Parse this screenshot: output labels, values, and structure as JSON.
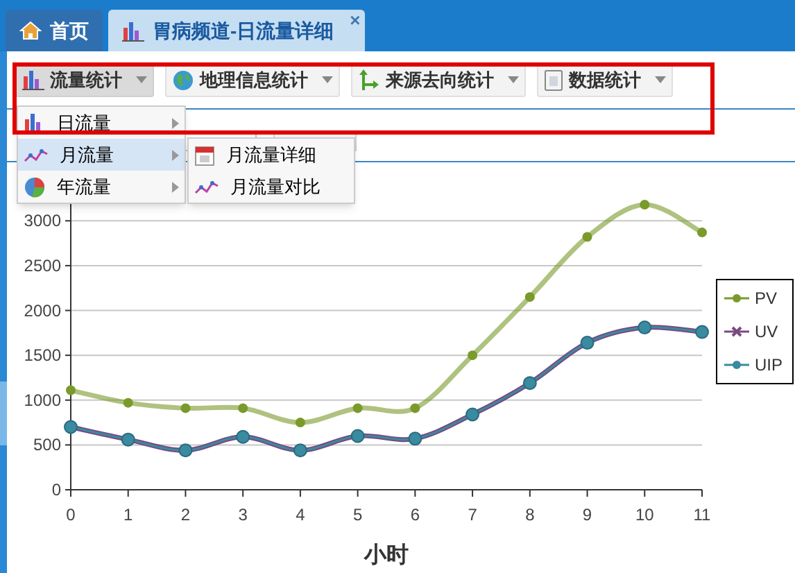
{
  "tabs": [
    {
      "label": "首页",
      "selected": false,
      "closable": false
    },
    {
      "label": "胃病频道-日流量详细",
      "selected": true,
      "closable": true
    }
  ],
  "close_symbol": "×",
  "toolbar": [
    {
      "label": "流量统计",
      "active": true
    },
    {
      "label": "地理信息统计",
      "active": false
    },
    {
      "label": "来源去向统计",
      "active": false
    },
    {
      "label": "数据统计",
      "active": false
    }
  ],
  "menu": [
    {
      "label": "日流量",
      "selected": false
    },
    {
      "label": "月流量",
      "selected": true
    },
    {
      "label": "年流量",
      "selected": false
    }
  ],
  "submenu": [
    {
      "label": "月流量详细"
    },
    {
      "label": "月流量对比"
    }
  ],
  "chart": {
    "chart_data": {
      "type": "line",
      "grid": true,
      "legend": "right",
      "xlabel": "小时",
      "categories": [
        "0",
        "1",
        "2",
        "3",
        "4",
        "5",
        "6",
        "7",
        "8",
        "9",
        "10",
        "11"
      ],
      "ylim": [
        0,
        3250
      ],
      "yticks": [
        0,
        500,
        1000,
        1500,
        2000,
        2500,
        3000
      ],
      "series": [
        {
          "name": "PV",
          "color": "#7a9a2a",
          "marker": "circle",
          "values": [
            1110,
            970,
            910,
            910,
            750,
            910,
            910,
            1500,
            2150,
            2820,
            3180,
            2870
          ]
        },
        {
          "name": "UV",
          "color": "#7a4a80",
          "marker": "x",
          "values": [
            700,
            560,
            440,
            590,
            440,
            600,
            570,
            840,
            1190,
            1640,
            1810,
            1760
          ]
        },
        {
          "name": "UIP",
          "color": "#3a8aa0",
          "marker": "circle",
          "values": [
            700,
            560,
            440,
            590,
            440,
            600,
            570,
            840,
            1190,
            1640,
            1810,
            1760
          ]
        }
      ]
    }
  }
}
